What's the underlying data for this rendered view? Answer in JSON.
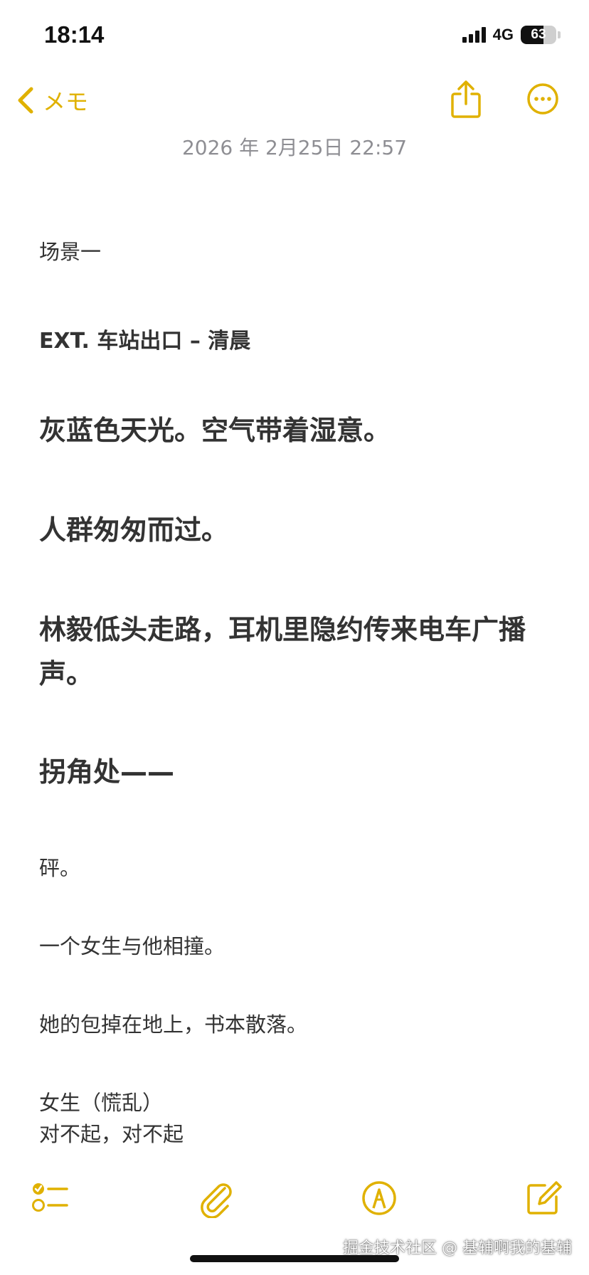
{
  "status_bar": {
    "time": "18:14",
    "network": "4G",
    "battery_text": "63",
    "battery_level": 0.63
  },
  "nav": {
    "back_label": "メモ",
    "share_icon": "share-icon",
    "more_icon": "ellipsis-circle-icon"
  },
  "note": {
    "date": "2026 年 2月25日 22:57",
    "lines": {
      "scene": "场景一",
      "ext": "EXT. 车站出口 – 清晨",
      "h1": "灰蓝色天光。空气带着湿意。",
      "h2": "人群匆匆而过。",
      "h3": "林毅低头走路，耳机里隐约传来电车广播声。",
      "h4": "拐角处——",
      "p1": "砰。",
      "p2": "一个女生与他相撞。",
      "p3": "她的包掉在地上，书本散落。",
      "p4": "女生（慌乱）",
      "p5": "对不起，对不起"
    }
  },
  "toolbar": {
    "checklist_icon": "checklist-icon",
    "attach_icon": "paperclip-icon",
    "markup_icon": "markup-pen-icon",
    "compose_icon": "compose-icon"
  },
  "watermark": "掘金技术社区 @ 基辅啊我的基辅",
  "colors": {
    "accent": "#e0b100",
    "text": "#333333",
    "date": "#8e8e93"
  }
}
